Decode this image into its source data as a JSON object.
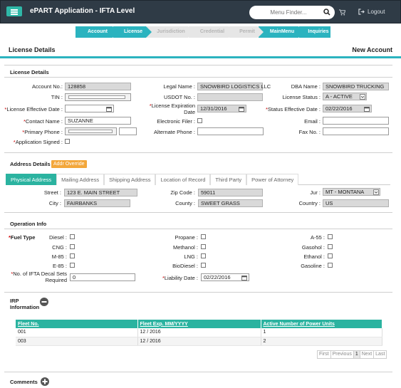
{
  "header": {
    "app_title": "ePART Application - IFTA Level",
    "search_placeholder": "Menu Finder...",
    "logout_label": "Logout"
  },
  "steps": [
    "Account",
    "License",
    "Jurisdiction",
    "Credential",
    "Permit",
    "MainMenu",
    "Inquiries"
  ],
  "page": {
    "title": "License Details",
    "new_account": "New Account"
  },
  "license": {
    "section_title": "License Details",
    "account_no_label": "Account No.:",
    "account_no": "128858",
    "legal_name_label": "Legal Name :",
    "legal_name": "SNOWBIRD LOGISTICS LLC",
    "dba_name_label": "DBA Name :",
    "dba_name": "SNOWBIRD TRUCKING",
    "tin_label": "TIN :",
    "usdot_label": "USDOT No. :",
    "license_status_label": "License Status :",
    "license_status": "A - ACTIVE",
    "effective_date_label": "License Effective Date :",
    "expiration_label_1": "License Expiration",
    "expiration_label_2": "Date",
    "expiration_date": "12/31/2016",
    "status_effective_label": "Status Effective Date :",
    "status_effective_date": "02/22/2016",
    "contact_label": "Contact Name :",
    "contact_name": "SUZANNE",
    "electronic_filer_label": "Electronic Filer :",
    "email_label": "Email :",
    "primary_phone_label": "Primary Phone :",
    "alternate_phone_label": "Alternate Phone :",
    "fax_label": "Fax No. :",
    "app_signed_label": "Application Signed :"
  },
  "address": {
    "section_title": "Address Details",
    "override_label": "Addr Override",
    "tabs": [
      "Physical Address",
      "Mailing Address",
      "Shipping Address",
      "Location of Record",
      "Third Party",
      "Power of Attorney"
    ],
    "street_label": "Street :",
    "street": "123 E. MAIN STREET",
    "zip_label": "Zip Code :",
    "zip": "59011",
    "jur_label": "Jur :",
    "jur": "MT - MONTANA",
    "city_label": "City :",
    "city": "FAIRBANKS",
    "county_label": "County :",
    "county": "SWEET GRASS",
    "country_label": "Country :",
    "country": "US"
  },
  "operation": {
    "section_title": "Operation Info",
    "fuel_type_label": "Fuel Type",
    "fuels": {
      "diesel": "Diesel :",
      "cng": "CNG :",
      "m85": "M-85 :",
      "e85": "E-85 :",
      "propane": "Propane :",
      "methanol": "Methanol :",
      "lng": "LNG :",
      "biodiesel": "BioDiesel :",
      "a55": "A-55 :",
      "gasohol": "Gasohol :",
      "ethanol": "Ethanol :",
      "gasoline": "Gasoline :"
    },
    "decal_label_1": "No. of IFTA Decal Sets",
    "decal_label_2": "Required",
    "decal_value": "0",
    "liability_label": "Liability Date :",
    "liability_date": "02/22/2016"
  },
  "irp": {
    "title_1": "IRP",
    "title_2": "Information",
    "columns": [
      "Fleet No.",
      "Fleet Exp. MM/YYYY",
      "Active Number of Power Units"
    ],
    "rows": [
      [
        "001",
        "12 / 2016",
        "1"
      ],
      [
        "003",
        "12 / 2016",
        "2"
      ]
    ],
    "pager": [
      "First",
      "Previous",
      "1",
      "Next",
      "Last"
    ]
  },
  "comments": {
    "title": "Comments"
  },
  "colors": {
    "accent": "#2bb3bf",
    "teal_tab": "#2bb3a0",
    "topbar": "#2f3b46",
    "override": "#f3a73b",
    "required": "#cc0000"
  }
}
